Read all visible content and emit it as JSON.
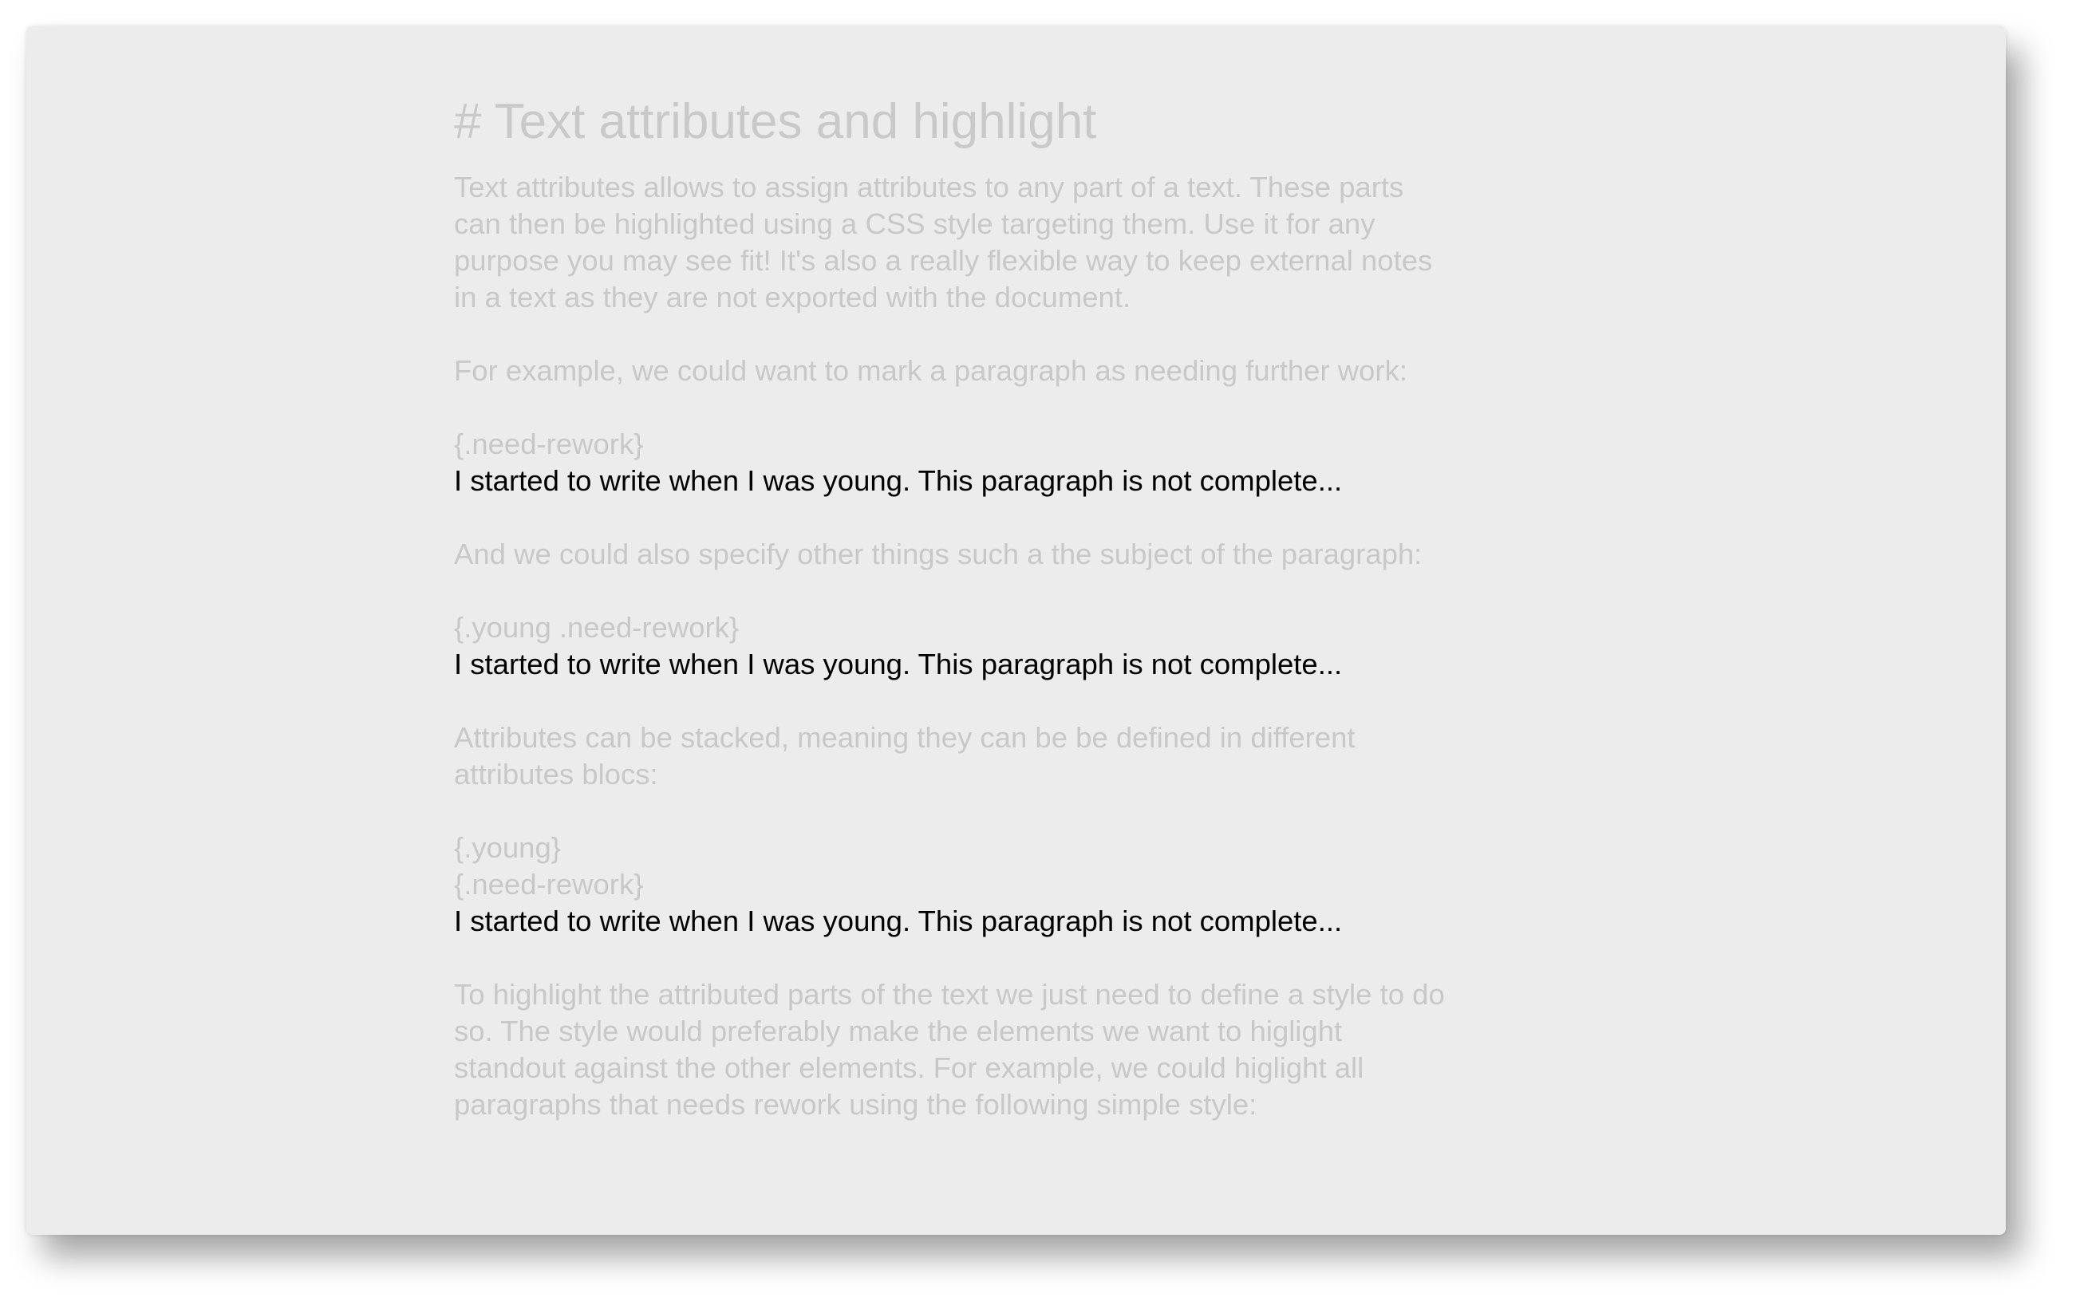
{
  "document": {
    "title": "# Text attributes and highlight",
    "lines": [
      {
        "text": "Text attributes allows to assign attributes to any part of a text. These parts",
        "style": "muted"
      },
      {
        "text": "can then be highlighted using a CSS style targeting them. Use it for any",
        "style": "muted"
      },
      {
        "text": "purpose you may see fit! It's also a really flexible way to keep external notes",
        "style": "muted"
      },
      {
        "text": "in a text as they are not exported with the document.",
        "style": "muted"
      },
      {
        "text": "",
        "style": "muted"
      },
      {
        "text": "For example, we could want to mark a paragraph as needing further work:",
        "style": "muted"
      },
      {
        "text": "",
        "style": "muted"
      },
      {
        "text": "{.need-rework}",
        "style": "muted"
      },
      {
        "text": "I started to write when I was young. This paragraph is not complete...",
        "style": "dark"
      },
      {
        "text": "",
        "style": "muted"
      },
      {
        "text": "And we could also specify other things such a the subject of the paragraph:",
        "style": "muted"
      },
      {
        "text": "",
        "style": "muted"
      },
      {
        "text": "{.young .need-rework}",
        "style": "muted"
      },
      {
        "text": "I started to write when I was young. This paragraph is not complete...",
        "style": "dark"
      },
      {
        "text": "",
        "style": "muted"
      },
      {
        "text": "Attributes can be stacked, meaning they can be be defined in different",
        "style": "muted"
      },
      {
        "text": "attributes blocs:",
        "style": "muted"
      },
      {
        "text": "",
        "style": "muted"
      },
      {
        "text": "{.young}",
        "style": "muted"
      },
      {
        "text": "{.need-rework}",
        "style": "muted"
      },
      {
        "text": "I started to write when I was young. This paragraph is not complete...",
        "style": "dark"
      },
      {
        "text": "",
        "style": "muted"
      },
      {
        "text": "To highlight the attributed parts of the text we just need to define a style to do",
        "style": "muted"
      },
      {
        "text": "so. The style would preferably make the elements we want to higlight",
        "style": "muted"
      },
      {
        "text": "standout against the other elements. For example, we could higlight all",
        "style": "muted"
      },
      {
        "text": "paragraphs that needs rework using the following simple style:",
        "style": "muted"
      }
    ]
  }
}
